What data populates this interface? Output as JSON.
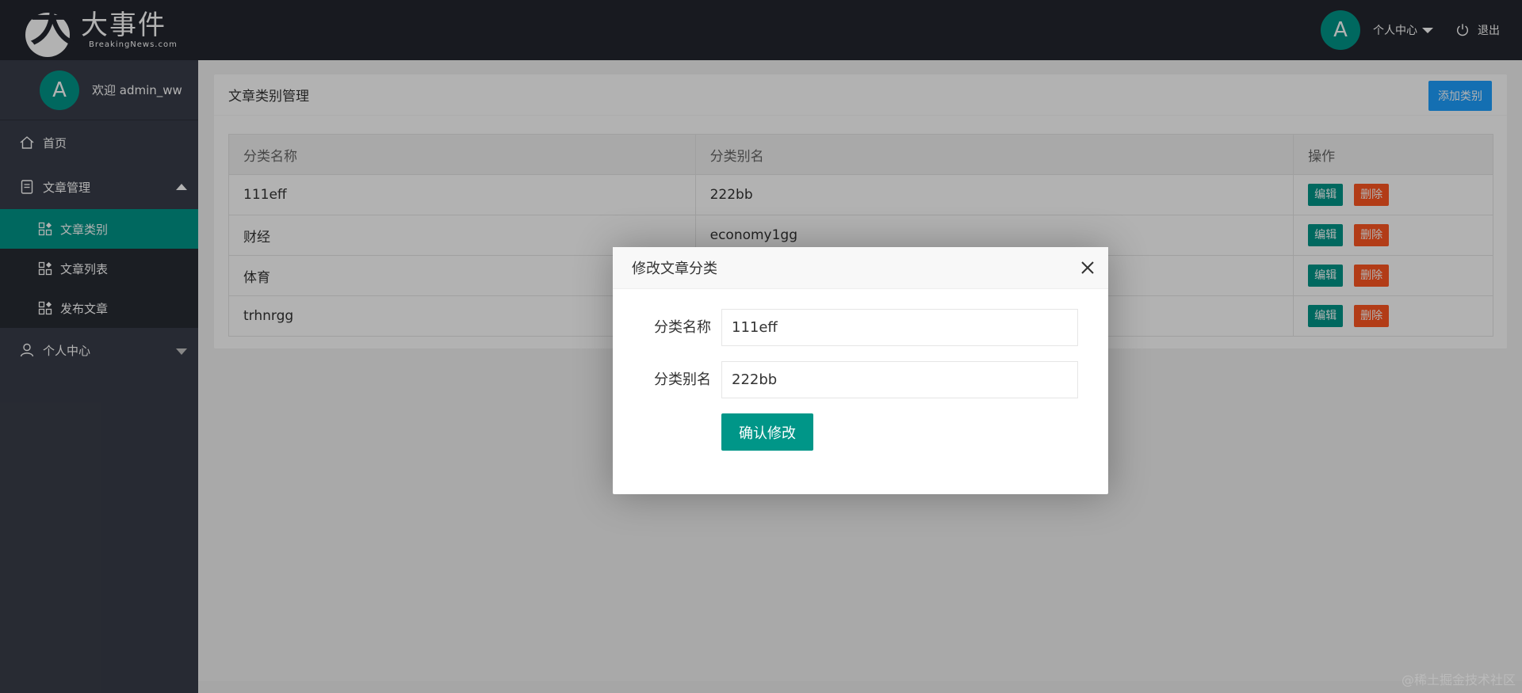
{
  "header": {
    "logo_title": "大事件",
    "logo_sub": "BreakingNews.com",
    "avatar_letter": "A",
    "user_center": "个人中心",
    "logout": "退出"
  },
  "sidebar": {
    "avatar_letter": "A",
    "welcome": "欢迎  admin_ww",
    "items": [
      {
        "label": "首页"
      },
      {
        "label": "文章管理"
      },
      {
        "label": "个人中心"
      }
    ],
    "sub_items": [
      {
        "label": "文章类别"
      },
      {
        "label": "文章列表"
      },
      {
        "label": "发布文章"
      }
    ]
  },
  "main": {
    "title": "文章类别管理",
    "add_button": "添加类别",
    "columns": [
      "分类名称",
      "分类别名",
      "操作"
    ],
    "rows": [
      {
        "name": "111eff",
        "alias": "222bb"
      },
      {
        "name": "财经",
        "alias": "economy1gg"
      },
      {
        "name": "体育",
        "alias": ""
      },
      {
        "name": "trhnrgg",
        "alias": ""
      }
    ],
    "edit_label": "编辑",
    "delete_label": "删除"
  },
  "dialog": {
    "title": "修改文章分类",
    "name_label": "分类名称",
    "name_value": "111eff",
    "alias_label": "分类别名",
    "alias_value": "222bb",
    "confirm": "确认修改"
  },
  "watermark": "@稀土掘金技术社区",
  "colors": {
    "header_bg": "#23262e",
    "sidebar_bg": "#393d49",
    "accent": "#009688",
    "add_button": "#1e9fff",
    "danger": "#ff5722"
  }
}
